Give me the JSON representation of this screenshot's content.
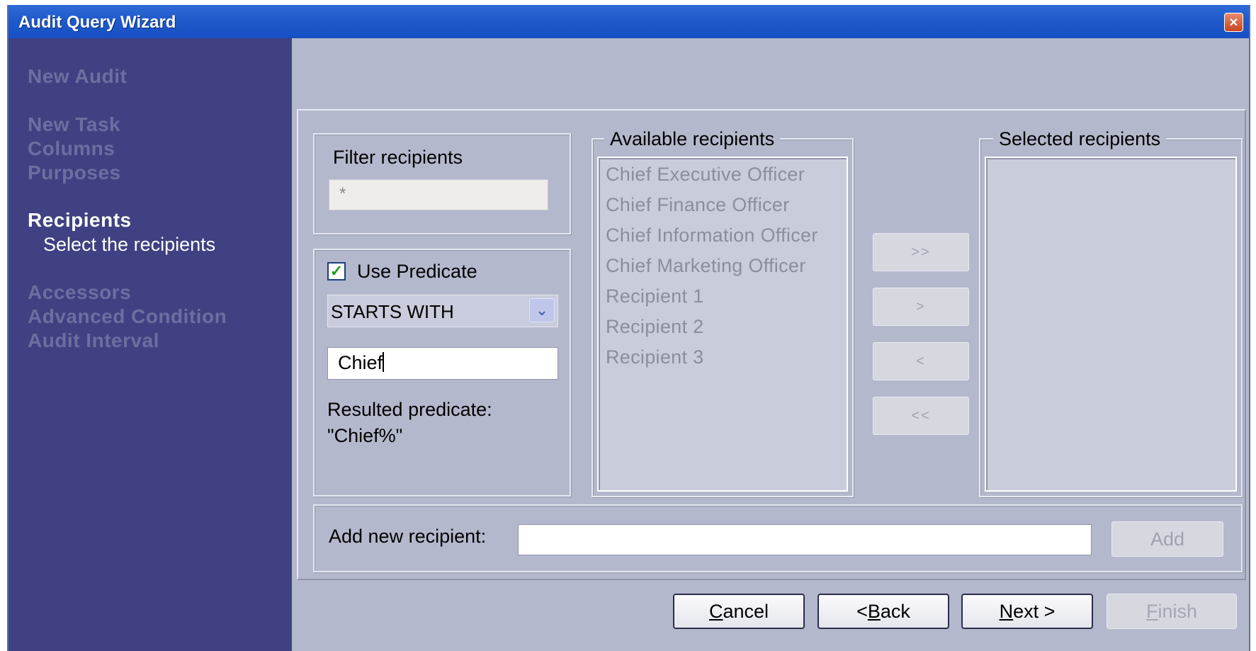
{
  "window": {
    "title": "Audit Query Wizard"
  },
  "sidebar": {
    "steps": [
      {
        "label": "New Audit"
      },
      {
        "label": "New Task"
      },
      {
        "label": "Columns"
      },
      {
        "label": "Purposes"
      },
      {
        "label": "Recipients",
        "subtitle": "Select the recipients"
      },
      {
        "label": "Accessors"
      },
      {
        "label": "Advanced Condition"
      },
      {
        "label": "Audit Interval"
      }
    ]
  },
  "filter": {
    "label": "Filter recipients",
    "value": "*"
  },
  "predicate": {
    "checkbox_label": "Use Predicate",
    "checked": true,
    "operator": "STARTS WITH",
    "value": "Chief",
    "result_label": "Resulted predicate:",
    "result_value": "\"Chief%\""
  },
  "available": {
    "title": "Available recipients",
    "items": [
      "Chief Executive Officer",
      "Chief Finance Officer",
      "Chief Information Officer",
      "Chief Marketing Officer",
      "Recipient 1",
      "Recipient 2",
      "Recipient 3"
    ]
  },
  "selected": {
    "title": "Selected recipients",
    "items": []
  },
  "move_buttons": {
    "add_all": ">>",
    "add": ">",
    "remove": "<",
    "remove_all": "<<"
  },
  "add_recipient": {
    "label": "Add new recipient:",
    "value": "",
    "button": "Add"
  },
  "footer": {
    "cancel_prefix": "",
    "cancel_mnemonic": "C",
    "cancel_rest": "ancel",
    "back_prefix": "< ",
    "back_mnemonic": "B",
    "back_rest": "ack",
    "next_prefix": "",
    "next_mnemonic": "N",
    "next_rest": "ext >",
    "finish_prefix": "",
    "finish_mnemonic": "F",
    "finish_rest": "inish"
  }
}
